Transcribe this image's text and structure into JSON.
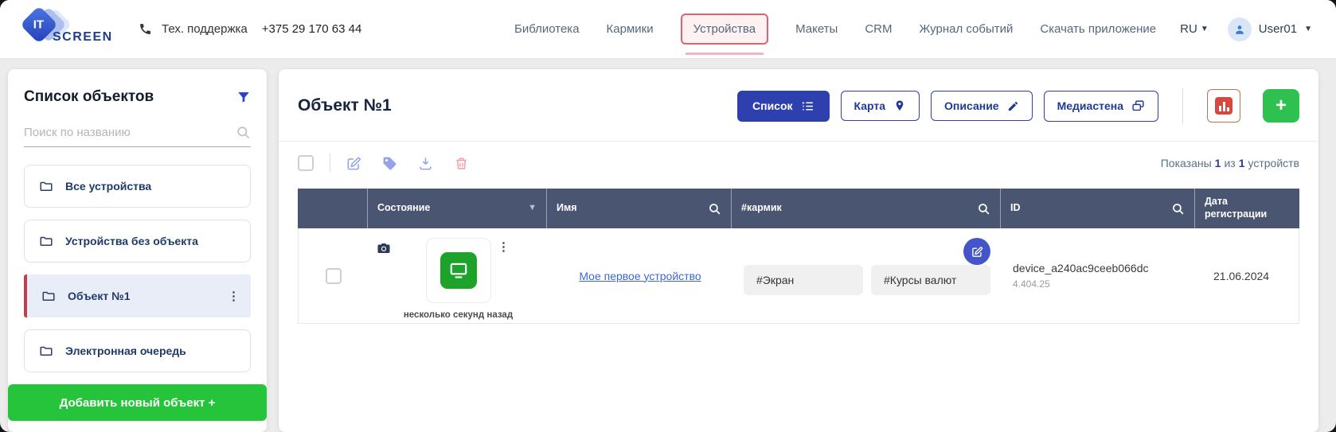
{
  "topbar": {
    "logo": {
      "it": "IT",
      "screen": "SCREEN"
    },
    "support": {
      "label": "Тех. поддержка",
      "phone": "+375 29 170 63 44"
    },
    "nav": [
      {
        "label": "Библиотека"
      },
      {
        "label": "Кармики"
      },
      {
        "label": "Устройства",
        "active": true
      },
      {
        "label": "Макеты"
      },
      {
        "label": "CRM"
      },
      {
        "label": "Журнал событий"
      },
      {
        "label": "Скачать приложение"
      }
    ],
    "language": "RU",
    "user": "User01"
  },
  "sidebar": {
    "title": "Список объектов",
    "search_placeholder": "Поиск по названию",
    "items": [
      {
        "label": "Все устройства"
      },
      {
        "label": "Устройства без объекта"
      },
      {
        "label": "Объект №1",
        "selected": true
      },
      {
        "label": "Электронная очередь"
      }
    ],
    "add_button": "Добавить новый объект +"
  },
  "main": {
    "title": "Объект №1",
    "view_buttons": [
      {
        "label": "Список",
        "active": true
      },
      {
        "label": "Карта"
      },
      {
        "label": "Описание"
      },
      {
        "label": "Медиастена"
      }
    ],
    "add_plus": "+",
    "summary": {
      "prefix": "Показаны",
      "shown": "1",
      "of": "из",
      "total": "1",
      "suffix": "устройств"
    },
    "table": {
      "columns": {
        "status": "Состояние",
        "name": "Имя",
        "karmik": "#кармик",
        "id": "ID",
        "date": "Дата регистрации"
      },
      "row": {
        "status_time": "несколько секунд назад",
        "name": "Мое первое устройство",
        "tags": [
          "#Экран",
          "#Курсы валют"
        ],
        "id": "device_a240ac9ceeb066dc",
        "version": "4.404.25",
        "date": "21.06.2024"
      }
    }
  },
  "colors": {
    "accent_blue": "#2e3fae",
    "accent_green": "#25c43b",
    "active_tab_red": "#e4606d",
    "table_header": "#4a5572",
    "selected_item_bg": "#e9edf8",
    "selected_item_bar": "#b8434e",
    "device_icon_green": "#1da32a"
  }
}
